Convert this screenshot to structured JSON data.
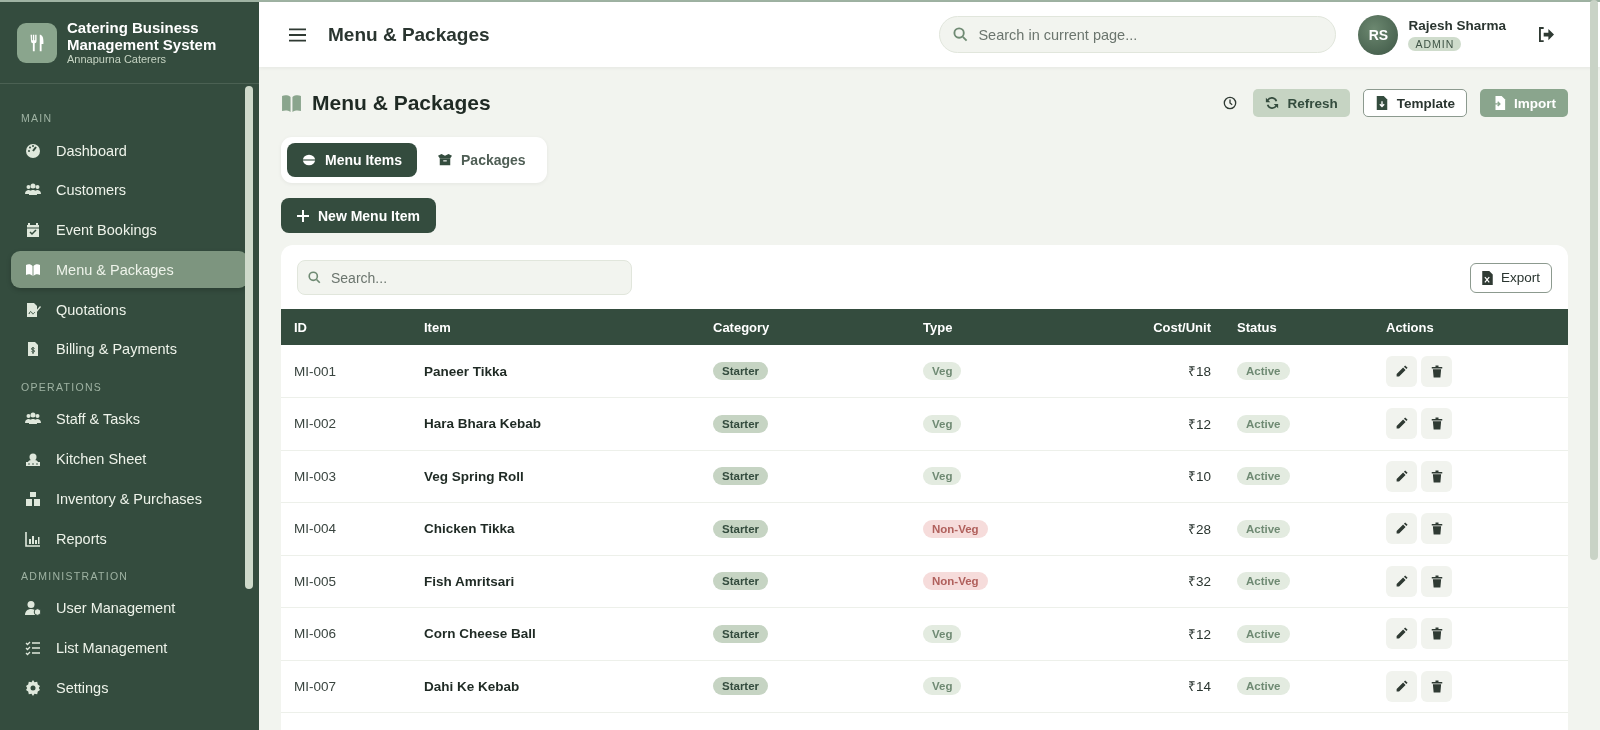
{
  "brand": {
    "title": "Catering Business Management System",
    "subtitle": "Annapurna Caterers"
  },
  "sidebar": {
    "sections": [
      {
        "label": "MAIN",
        "items": [
          {
            "label": "Dashboard",
            "selected": false
          },
          {
            "label": "Customers",
            "selected": false
          },
          {
            "label": "Event Bookings",
            "selected": false
          },
          {
            "label": "Menu & Packages",
            "selected": true
          },
          {
            "label": "Quotations",
            "selected": false
          },
          {
            "label": "Billing & Payments",
            "selected": false
          }
        ]
      },
      {
        "label": "OPERATIONS",
        "items": [
          {
            "label": "Staff & Tasks",
            "selected": false
          },
          {
            "label": "Kitchen Sheet",
            "selected": false
          },
          {
            "label": "Inventory & Purchases",
            "selected": false
          },
          {
            "label": "Reports",
            "selected": false
          }
        ]
      },
      {
        "label": "ADMINISTRATION",
        "items": [
          {
            "label": "User Management",
            "selected": false
          },
          {
            "label": "List Management",
            "selected": false
          },
          {
            "label": "Settings",
            "selected": false
          }
        ]
      }
    ]
  },
  "header": {
    "title": "Menu & Packages",
    "search": {
      "placeholder": "Search in current page..."
    },
    "user": {
      "initials": "RS",
      "name": "Rajesh Sharma",
      "role": "ADMIN"
    }
  },
  "page": {
    "title": "Menu & Packages",
    "actions": [
      {
        "label": "Refresh",
        "kind": "soft"
      },
      {
        "label": "Template",
        "kind": "outline"
      },
      {
        "label": "Import",
        "kind": "muted"
      }
    ]
  },
  "tabs": [
    {
      "label": "Menu Items",
      "selected": true
    },
    {
      "label": "Packages",
      "selected": false
    }
  ],
  "new_button": "New Menu Item",
  "table": {
    "search": {
      "placeholder": "Search..."
    },
    "export": "Export",
    "columns": [
      "ID",
      "Item",
      "Category",
      "Type",
      "Cost/Unit",
      "Status",
      "Actions"
    ],
    "rows": [
      {
        "id": "MI-001",
        "item": "Paneer Tikka",
        "category": "Starter",
        "type": "Veg",
        "veg": true,
        "cost": "₹18",
        "status": "Active"
      },
      {
        "id": "MI-002",
        "item": "Hara Bhara Kebab",
        "category": "Starter",
        "type": "Veg",
        "veg": true,
        "cost": "₹12",
        "status": "Active"
      },
      {
        "id": "MI-003",
        "item": "Veg Spring Roll",
        "category": "Starter",
        "type": "Veg",
        "veg": true,
        "cost": "₹10",
        "status": "Active"
      },
      {
        "id": "MI-004",
        "item": "Chicken Tikka",
        "category": "Starter",
        "type": "Non-Veg",
        "veg": false,
        "cost": "₹28",
        "status": "Active"
      },
      {
        "id": "MI-005",
        "item": "Fish Amritsari",
        "category": "Starter",
        "type": "Non-Veg",
        "veg": false,
        "cost": "₹32",
        "status": "Active"
      },
      {
        "id": "MI-006",
        "item": "Corn Cheese Ball",
        "category": "Starter",
        "type": "Veg",
        "veg": true,
        "cost": "₹12",
        "status": "Active"
      },
      {
        "id": "MI-007",
        "item": "Dahi Ke Kebab",
        "category": "Starter",
        "type": "Veg",
        "veg": true,
        "cost": "₹14",
        "status": "Active"
      }
    ]
  }
}
